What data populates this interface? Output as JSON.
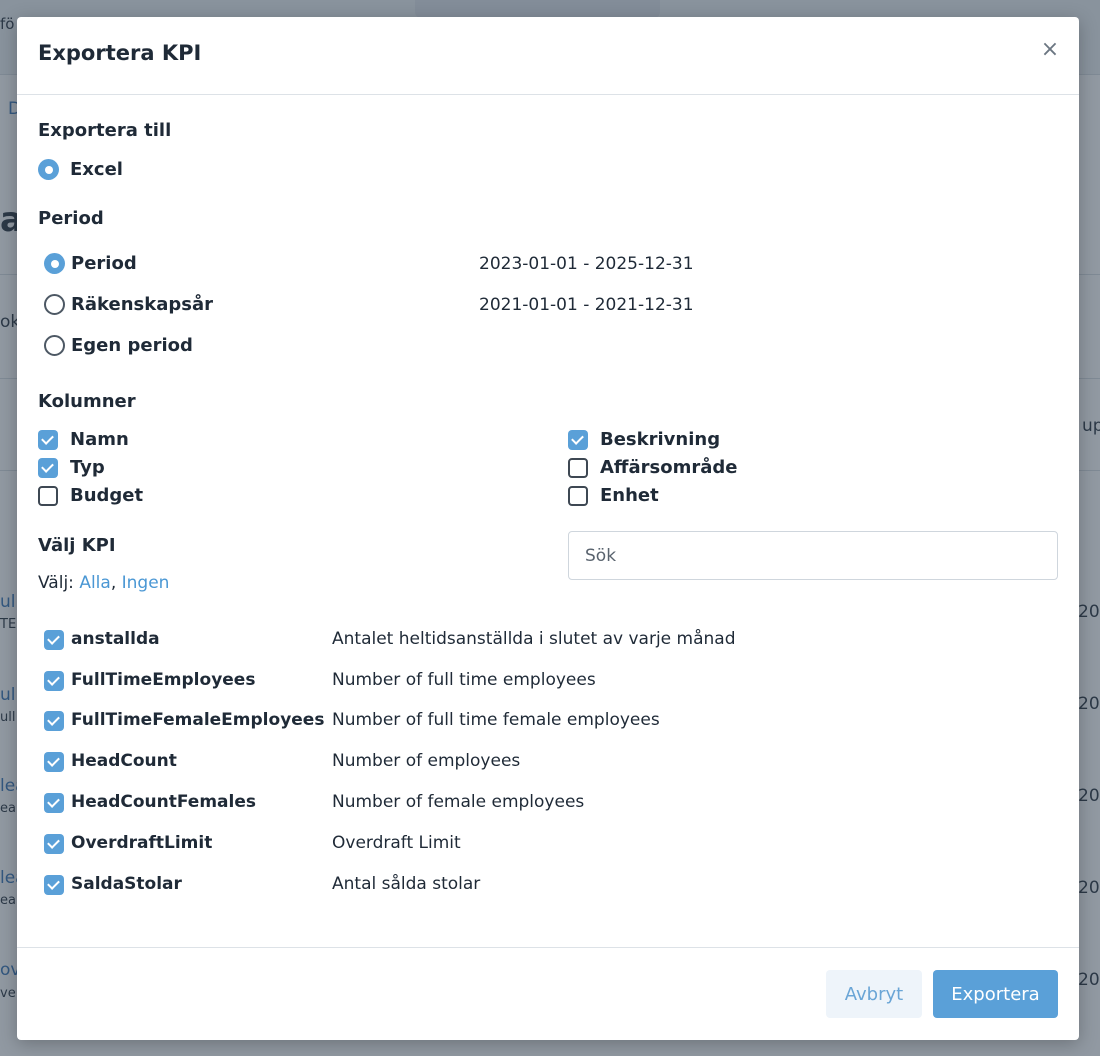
{
  "background": {
    "texts": [
      "fö",
      "D",
      "a",
      "ok",
      "up",
      "ul",
      "TE",
      "ul",
      "ull",
      "lea",
      "ea",
      "lea",
      "ea",
      "ov",
      "ve",
      "20",
      "20",
      "20",
      "20",
      "20"
    ]
  },
  "modal": {
    "title": "Exportera KPI",
    "close_label": "×",
    "export_to": {
      "label": "Exportera till",
      "options": [
        {
          "label": "Excel",
          "checked": true
        }
      ]
    },
    "period": {
      "label": "Period",
      "options": [
        {
          "label": "Period",
          "range": "2023-01-01 - 2025-12-31",
          "checked": true
        },
        {
          "label": "Räkenskapsår",
          "range": "2021-01-01 - 2021-12-31",
          "checked": false
        },
        {
          "label": "Egen period",
          "range": "",
          "checked": false
        }
      ]
    },
    "columns": {
      "label": "Kolumner",
      "items": [
        {
          "label": "Namn",
          "checked": true
        },
        {
          "label": "Typ",
          "checked": true
        },
        {
          "label": "Budget",
          "checked": false
        },
        {
          "label": "Beskrivning",
          "checked": true
        },
        {
          "label": "Affärsområde",
          "checked": false
        },
        {
          "label": "Enhet",
          "checked": false
        }
      ]
    },
    "select_kpi": {
      "label": "Välj KPI",
      "choose_prefix": "Välj:",
      "all_label": "Alla",
      "separator": ",",
      "none_label": "Ingen",
      "search_placeholder": "Sök",
      "search_value": ""
    },
    "kpis": [
      {
        "name": "anstallda",
        "description": "Antalet heltidsanställda i slutet av varje månad",
        "checked": true
      },
      {
        "name": "FullTimeEmployees",
        "description": "Number of full time employees",
        "checked": true
      },
      {
        "name": "FullTimeFemaleEmployees",
        "description": "Number of full time female employees",
        "checked": true
      },
      {
        "name": "HeadCount",
        "description": "Number of employees",
        "checked": true
      },
      {
        "name": "HeadCountFemales",
        "description": "Number of female employees",
        "checked": true
      },
      {
        "name": "OverdraftLimit",
        "description": "Overdraft Limit",
        "checked": true
      },
      {
        "name": "SaldaStolar",
        "description": "Antal sålda stolar",
        "checked": true
      }
    ],
    "footer": {
      "cancel_label": "Avbryt",
      "export_label": "Exportera"
    }
  }
}
